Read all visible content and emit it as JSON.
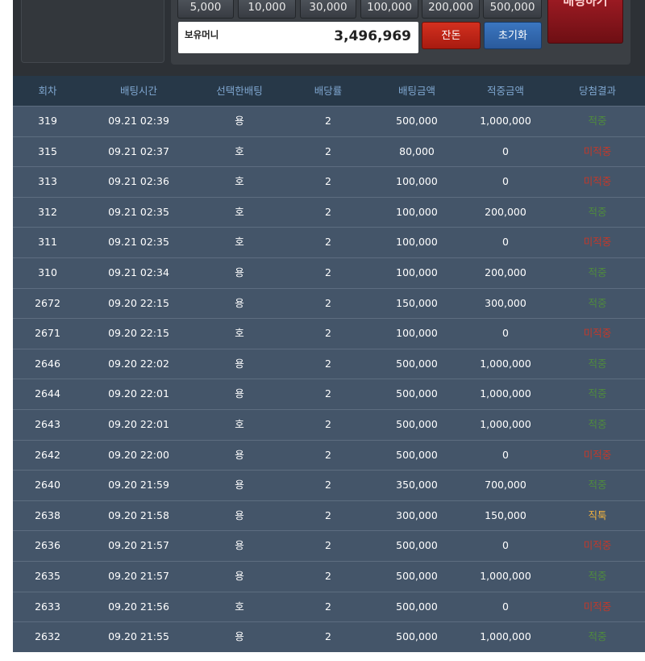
{
  "chips": [
    "5,000",
    "10,000",
    "30,000",
    "100,000",
    "200,000",
    "500,000"
  ],
  "bet_button_label": "배팅하기",
  "money": {
    "label": "보유머니",
    "value": "3,496,969"
  },
  "buttons": {
    "change": "잔돈",
    "reset": "초기화"
  },
  "colors": {
    "win": "#4f8a3e",
    "lose": "#c0392b",
    "special": "#f2b33d"
  },
  "table": {
    "headers": [
      "회차",
      "배팅시간",
      "선택한배팅",
      "배당률",
      "배팅금액",
      "적중금액",
      "당첨결과"
    ],
    "rows": [
      {
        "round": "319",
        "time": "09.21 02:39",
        "choice": "용",
        "odds": "2",
        "bet": "500,000",
        "won": "1,000,000",
        "result": "적중",
        "status": "win"
      },
      {
        "round": "315",
        "time": "09.21 02:37",
        "choice": "호",
        "odds": "2",
        "bet": "80,000",
        "won": "0",
        "result": "미적중",
        "status": "lose"
      },
      {
        "round": "313",
        "time": "09.21 02:36",
        "choice": "호",
        "odds": "2",
        "bet": "100,000",
        "won": "0",
        "result": "미적중",
        "status": "lose"
      },
      {
        "round": "312",
        "time": "09.21 02:35",
        "choice": "호",
        "odds": "2",
        "bet": "100,000",
        "won": "200,000",
        "result": "적중",
        "status": "win"
      },
      {
        "round": "311",
        "time": "09.21 02:35",
        "choice": "호",
        "odds": "2",
        "bet": "100,000",
        "won": "0",
        "result": "미적중",
        "status": "lose"
      },
      {
        "round": "310",
        "time": "09.21 02:34",
        "choice": "용",
        "odds": "2",
        "bet": "100,000",
        "won": "200,000",
        "result": "적중",
        "status": "win"
      },
      {
        "round": "2672",
        "time": "09.20 22:15",
        "choice": "용",
        "odds": "2",
        "bet": "150,000",
        "won": "300,000",
        "result": "적중",
        "status": "win"
      },
      {
        "round": "2671",
        "time": "09.20 22:15",
        "choice": "호",
        "odds": "2",
        "bet": "100,000",
        "won": "0",
        "result": "미적중",
        "status": "lose"
      },
      {
        "round": "2646",
        "time": "09.20 22:02",
        "choice": "용",
        "odds": "2",
        "bet": "500,000",
        "won": "1,000,000",
        "result": "적중",
        "status": "win"
      },
      {
        "round": "2644",
        "time": "09.20 22:01",
        "choice": "용",
        "odds": "2",
        "bet": "500,000",
        "won": "1,000,000",
        "result": "적중",
        "status": "win"
      },
      {
        "round": "2643",
        "time": "09.20 22:01",
        "choice": "호",
        "odds": "2",
        "bet": "500,000",
        "won": "1,000,000",
        "result": "적중",
        "status": "win"
      },
      {
        "round": "2642",
        "time": "09.20 22:00",
        "choice": "용",
        "odds": "2",
        "bet": "500,000",
        "won": "0",
        "result": "미적중",
        "status": "lose"
      },
      {
        "round": "2640",
        "time": "09.20 21:59",
        "choice": "용",
        "odds": "2",
        "bet": "350,000",
        "won": "700,000",
        "result": "적중",
        "status": "win"
      },
      {
        "round": "2638",
        "time": "09.20 21:58",
        "choice": "용",
        "odds": "2",
        "bet": "300,000",
        "won": "150,000",
        "result": "직툭",
        "status": "special"
      },
      {
        "round": "2636",
        "time": "09.20 21:57",
        "choice": "용",
        "odds": "2",
        "bet": "500,000",
        "won": "0",
        "result": "미적중",
        "status": "lose"
      },
      {
        "round": "2635",
        "time": "09.20 21:57",
        "choice": "용",
        "odds": "2",
        "bet": "500,000",
        "won": "1,000,000",
        "result": "적중",
        "status": "win"
      },
      {
        "round": "2633",
        "time": "09.20 21:56",
        "choice": "호",
        "odds": "2",
        "bet": "500,000",
        "won": "0",
        "result": "미적중",
        "status": "lose"
      },
      {
        "round": "2632",
        "time": "09.20 21:55",
        "choice": "용",
        "odds": "2",
        "bet": "500,000",
        "won": "1,000,000",
        "result": "적중",
        "status": "win"
      }
    ]
  }
}
